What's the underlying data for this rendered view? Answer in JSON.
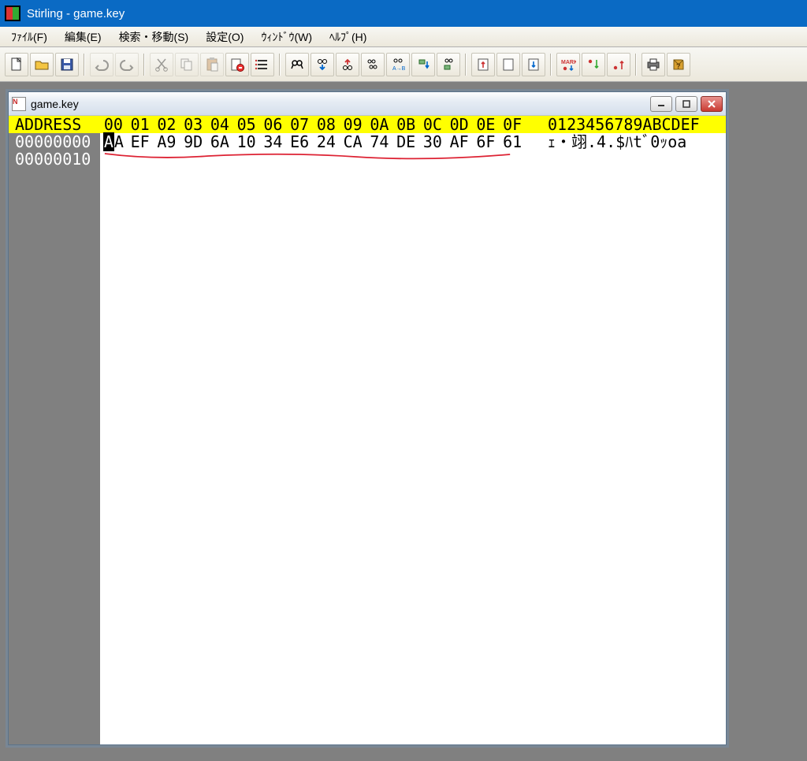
{
  "titlebar": {
    "title": "Stirling - game.key"
  },
  "menu": {
    "file": "ﾌｧｲﾙ(F)",
    "edit": "編集(E)",
    "search": "検索・移動(S)",
    "settings": "設定(O)",
    "window": "ｳｨﾝﾄﾞｳ(W)",
    "help": "ﾍﾙﾌﾟ(H)"
  },
  "child": {
    "title": "game.key"
  },
  "hex": {
    "address_label": "ADDRESS",
    "col_headers": [
      "00",
      "01",
      "02",
      "03",
      "04",
      "05",
      "06",
      "07",
      "08",
      "09",
      "0A",
      "0B",
      "0C",
      "0D",
      "0E",
      "0F"
    ],
    "ascii_header": "0123456789ABCDEF",
    "rows": [
      {
        "addr": "00000000",
        "bytes": [
          "AA",
          "EF",
          "A9",
          "9D",
          "6A",
          "10",
          "34",
          "E6",
          "24",
          "CA",
          "74",
          "DE",
          "30",
          "AF",
          "6F",
          "61"
        ],
        "ascii": "ｪ・翊.4.$ﾊtﾞ0ｯoa"
      },
      {
        "addr": "00000010",
        "bytes": [],
        "ascii": ""
      }
    ]
  }
}
